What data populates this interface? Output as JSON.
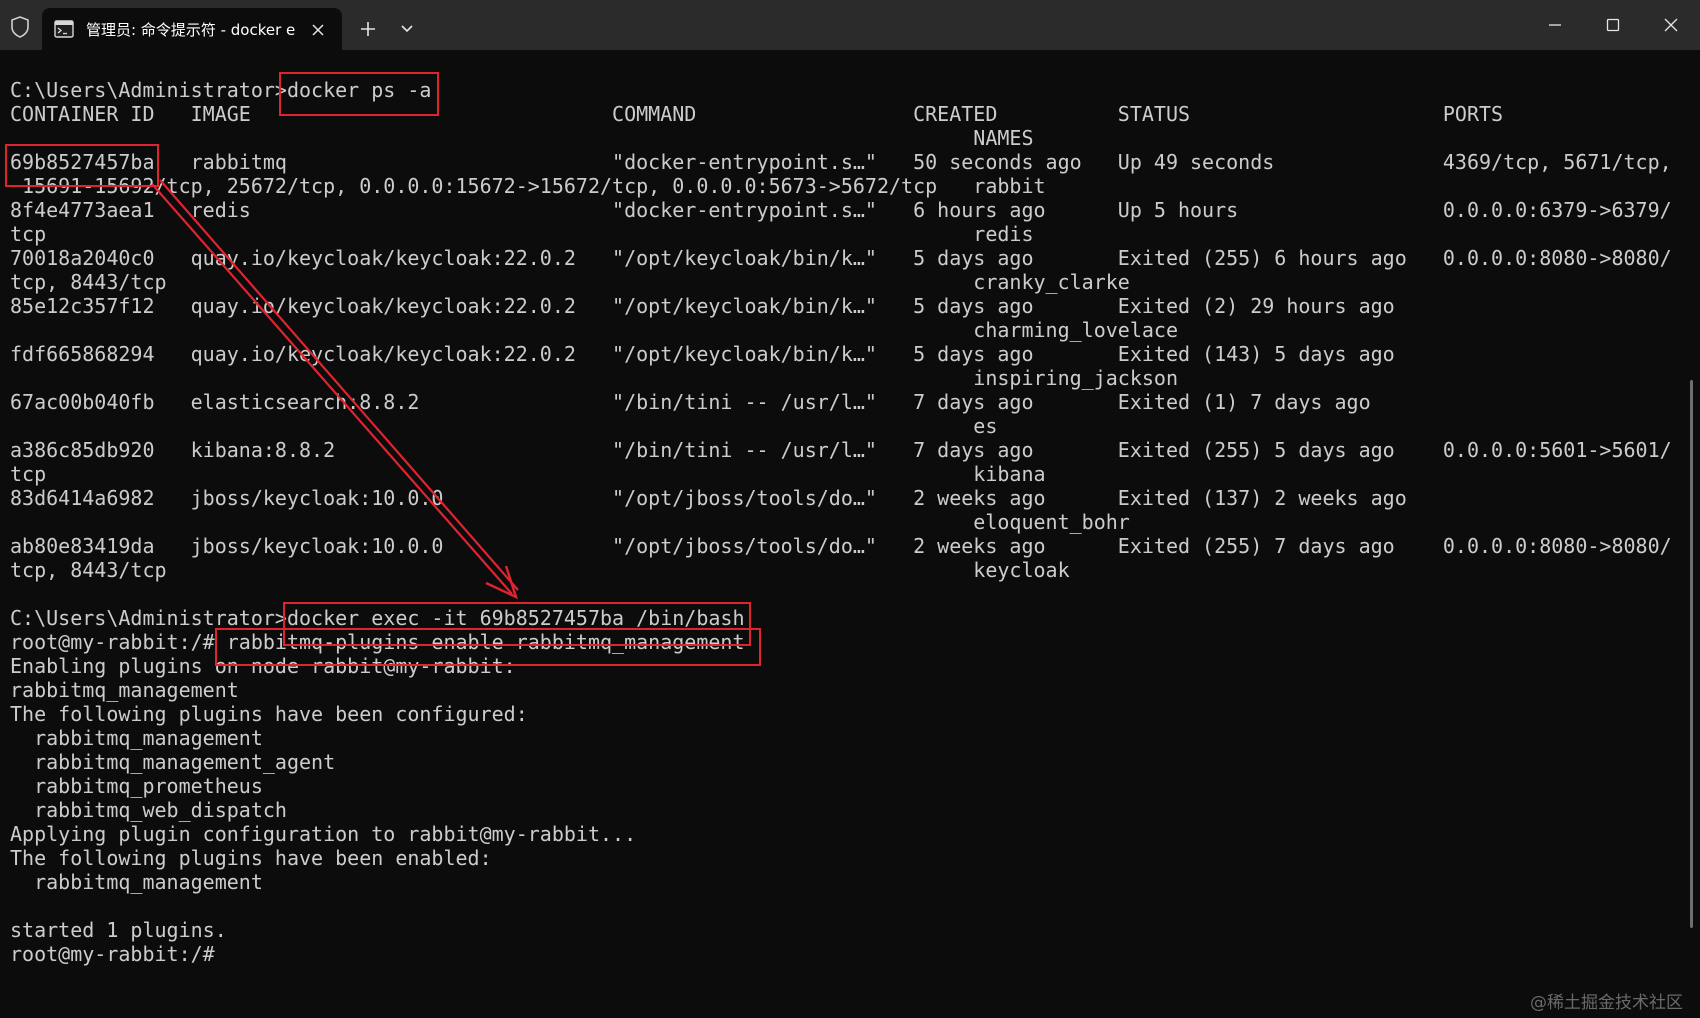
{
  "window": {
    "tab_title": "管理员: 命令提示符 - docker  e",
    "icons": [
      "shield-icon",
      "terminal-icon",
      "close-icon",
      "plus-icon",
      "chevron-down-icon",
      "minimize-icon",
      "maximize-icon",
      "window-close-icon"
    ]
  },
  "terminal": {
    "lines": [
      "C:\\Users\\Administrator>docker ps -a",
      "CONTAINER ID   IMAGE                              COMMAND                  CREATED          STATUS                     PORTS",
      "                                                                                NAMES",
      "69b8527457ba   rabbitmq                           \"docker-entrypoint.s…\"   50 seconds ago   Up 49 seconds              4369/tcp, 5671/tcp,",
      " 15691-15692/tcp, 25672/tcp, 0.0.0.0:15672->15672/tcp, 0.0.0.0:5673->5672/tcp   rabbit",
      "8f4e4773aea1   redis                              \"docker-entrypoint.s…\"   6 hours ago      Up 5 hours                 0.0.0.0:6379->6379/",
      "tcp                                                                             redis",
      "70018a2040c0   quay.io/keycloak/keycloak:22.0.2   \"/opt/keycloak/bin/k…\"   5 days ago       Exited (255) 6 hours ago   0.0.0.0:8080->8080/",
      "tcp, 8443/tcp                                                                   cranky_clarke",
      "85e12c357f12   quay.io/keycloak/keycloak:22.0.2   \"/opt/keycloak/bin/k…\"   5 days ago       Exited (2) 29 hours ago",
      "                                                                                charming_lovelace",
      "fdf665868294   quay.io/keycloak/keycloak:22.0.2   \"/opt/keycloak/bin/k…\"   5 days ago       Exited (143) 5 days ago",
      "                                                                                inspiring_jackson",
      "67ac00b040fb   elasticsearch:8.8.2                \"/bin/tini -- /usr/l…\"   7 days ago       Exited (1) 7 days ago",
      "                                                                                es",
      "a386c85db920   kibana:8.8.2                       \"/bin/tini -- /usr/l…\"   7 days ago       Exited (255) 5 days ago    0.0.0.0:5601->5601/",
      "tcp                                                                             kibana",
      "83d6414a6982   jboss/keycloak:10.0.0              \"/opt/jboss/tools/do…\"   2 weeks ago      Exited (137) 2 weeks ago",
      "                                                                                eloquent_bohr",
      "ab80e83419da   jboss/keycloak:10.0.0              \"/opt/jboss/tools/do…\"   2 weeks ago      Exited (255) 7 days ago    0.0.0.0:8080->8080/",
      "tcp, 8443/tcp                                                                   keycloak",
      "",
      "C:\\Users\\Administrator>docker exec -it 69b8527457ba /bin/bash",
      "root@my-rabbit:/# rabbitmq-plugins enable rabbitmq_management",
      "Enabling plugins on node rabbit@my-rabbit:",
      "rabbitmq_management",
      "The following plugins have been configured:",
      "  rabbitmq_management",
      "  rabbitmq_management_agent",
      "  rabbitmq_prometheus",
      "  rabbitmq_web_dispatch",
      "Applying plugin configuration to rabbit@my-rabbit...",
      "The following plugins have been enabled:",
      "  rabbitmq_management",
      "",
      "started 1 plugins.",
      "root@my-rabbit:/#"
    ]
  },
  "annotations": {
    "color": "#e0242f"
  },
  "colors": {
    "terminal_bg": "#0c0c0c",
    "terminal_fg": "#cccccc",
    "titlebar_bg": "#2b2b2b"
  },
  "watermark": "@稀土掘金技术社区"
}
